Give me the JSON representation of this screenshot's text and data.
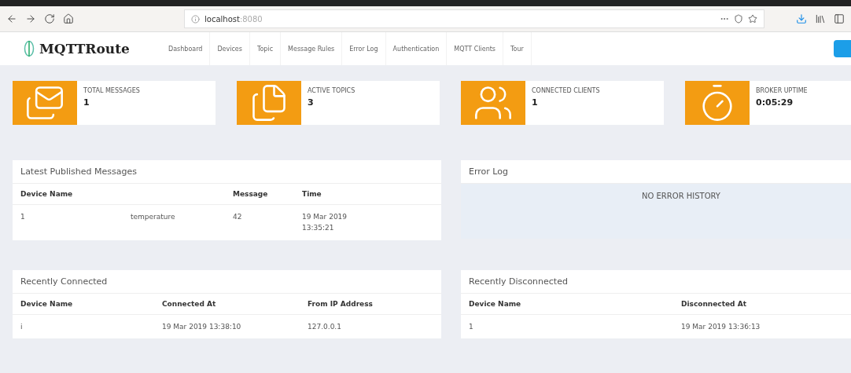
{
  "browser": {
    "url_host": "localhost",
    "url_port": ":8080"
  },
  "app": {
    "logo": "MQTTRoute",
    "nav": [
      {
        "label": "Dashboard",
        "selected": false
      },
      {
        "label": "Devices",
        "selected": false
      },
      {
        "label": "Topic",
        "selected": false
      },
      {
        "label": "Message Rules",
        "selected": false
      },
      {
        "label": "Error Log",
        "selected": false
      },
      {
        "label": "Authentication",
        "selected": false
      },
      {
        "label": "MQTT Clients",
        "selected": false
      },
      {
        "label": "Tour",
        "selected": false
      }
    ]
  },
  "stats": [
    {
      "kind": "messages",
      "label": "TOTAL MESSAGES",
      "value": "1"
    },
    {
      "kind": "topics",
      "label": "ACTIVE TOPICS",
      "value": "3"
    },
    {
      "kind": "clients",
      "label": "CONNECTED CLIENTS",
      "value": "1"
    },
    {
      "kind": "uptime",
      "label": "BROKER UPTIME",
      "value": "0:05:29"
    }
  ],
  "latest_messages": {
    "title": "Latest Published Messages",
    "columns": {
      "device": "Device Name",
      "message": "Message",
      "time": "Time"
    },
    "rows": [
      {
        "device": "1",
        "column_2": "temperature",
        "message": "42",
        "time": "19 Mar 2019 13:35:21"
      }
    ]
  },
  "error_log": {
    "title": "Error Log",
    "empty_text": "NO ERROR HISTORY"
  },
  "recently_connected": {
    "title": "Recently Connected",
    "columns": [
      "Device Name",
      "Connected At",
      "From IP Address"
    ],
    "rows": [
      [
        "i",
        "19 Mar 2019 13:38:10",
        "127.0.0.1"
      ]
    ]
  },
  "recently_disconnected": {
    "title": "Recently Disconnected",
    "columns": [
      "Device Name",
      "Disconnected At"
    ],
    "rows": [
      [
        "1",
        "19 Mar 2019 13:36:13"
      ]
    ]
  }
}
